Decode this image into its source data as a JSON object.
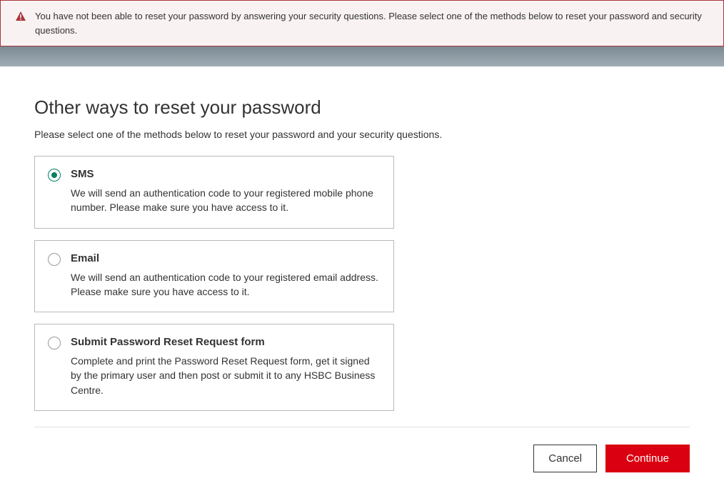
{
  "alert": {
    "message": "You have not been able to reset your password by answering your security questions. Please select one of the methods below to reset your password and security questions."
  },
  "page": {
    "title": "Other ways to reset your password",
    "subtitle": "Please select one of the methods below to reset your password and your security questions."
  },
  "options": [
    {
      "title": "SMS",
      "description": "We will send an authentication code to your registered mobile phone number. Please make sure you have access to it.",
      "selected": true
    },
    {
      "title": "Email",
      "description": "We will send an authentication code to your registered email address. Please make sure you have access to it.",
      "selected": false
    },
    {
      "title": "Submit Password Reset Request form",
      "description": "Complete and print the Password Reset Request form, get it signed by the primary user and then post or submit it to any HSBC Business Centre.",
      "selected": false
    }
  ],
  "buttons": {
    "cancel": "Cancel",
    "continue": "Continue"
  }
}
